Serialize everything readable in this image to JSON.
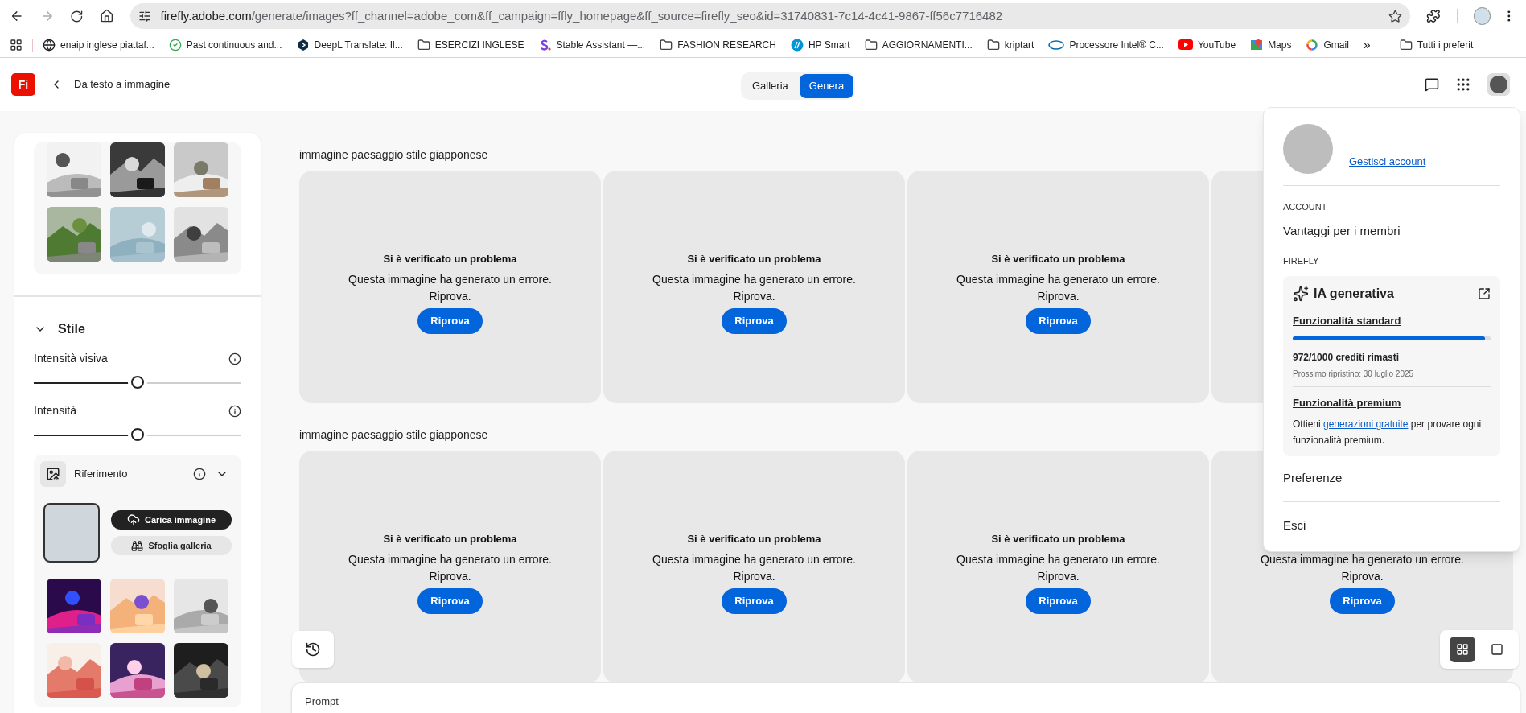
{
  "browser": {
    "url_host": "firefly.adobe.com",
    "url_path": "/generate/images?ff_channel=adobe_com&ff_campaign=ffly_homepage&ff_source=firefly_seo&id=31740831-7c14-4c41-9867-ff56c7716482",
    "bookmarks": [
      {
        "kind": "globe",
        "label": "enaip inglese piattaf..."
      },
      {
        "kind": "check",
        "label": "Past continuous and..."
      },
      {
        "kind": "hexagon",
        "label": "DeepL Translate: Il..."
      },
      {
        "kind": "folder",
        "label": "ESERCIZI INGLESE"
      },
      {
        "kind": "s-logo",
        "label": "Stable Assistant —..."
      },
      {
        "kind": "folder",
        "label": "FASHION RESEARCH"
      },
      {
        "kind": "hp",
        "label": "HP Smart"
      },
      {
        "kind": "folder",
        "label": "AGGIORNAMENTI..."
      },
      {
        "kind": "folder",
        "label": "kriptart"
      },
      {
        "kind": "intel",
        "label": "Processore Intel® C..."
      },
      {
        "kind": "youtube",
        "label": "YouTube"
      },
      {
        "kind": "maps",
        "label": "Maps"
      },
      {
        "kind": "google",
        "label": "Gmail"
      }
    ],
    "overflow": "»",
    "all_bookmarks": "Tutti i preferit"
  },
  "header": {
    "logo": "Fi",
    "back_label": "Da testo a immagine",
    "tabs": [
      {
        "label": "Galleria",
        "selected": false
      },
      {
        "label": "Genera",
        "selected": true
      }
    ]
  },
  "sidebar": {
    "style": {
      "title": "Stile",
      "expanded": true,
      "sliders": [
        {
          "label": "Intensità visiva",
          "level": 0.5
        },
        {
          "label": "Intensità",
          "level": 0.5
        }
      ]
    },
    "reference": {
      "title": "Riferimento",
      "expanded": true,
      "upload_button": "Carica immagine",
      "browse_button": "Sfoglia galleria"
    }
  },
  "groups": [
    {
      "prompt": "immagine paesaggio stile giapponese",
      "cards": [
        {
          "title": "Si è verificato un problema",
          "message": "Questa immagine ha generato un errore.",
          "hint": "Riprova.",
          "button": "Riprova"
        },
        {
          "title": "Si è verificato un problema",
          "message": "Questa immagine ha generato un errore.",
          "hint": "Riprova.",
          "button": "Riprova"
        },
        {
          "title": "Si è verificato un problema",
          "message": "Questa immagine ha generato un errore.",
          "hint": "Riprova.",
          "button": "Riprova"
        }
      ]
    },
    {
      "prompt": "immagine paesaggio stile giapponese",
      "cards": [
        {
          "title": "Si è verificato un problema",
          "message": "Questa immagine ha generato un errore.",
          "hint": "Riprova.",
          "button": "Riprova"
        },
        {
          "title": "Si è verificato un problema",
          "message": "Questa immagine ha generato un errore.",
          "hint": "Riprova.",
          "button": "Riprova"
        },
        {
          "title": "Si è verificato un problema",
          "message": "Questa immagine ha generato un errore.",
          "hint": "Riprova.",
          "button": "Riprova"
        },
        {
          "message": "Questa immagine ha generato un errore.",
          "hint": "Riprova.",
          "button": "Riprova"
        }
      ]
    }
  ],
  "view_toggle": [
    {
      "kind": "grid",
      "selected": true
    },
    {
      "kind": "single",
      "selected": false
    }
  ],
  "prompt_bar": {
    "label": "Prompt"
  },
  "account_menu": {
    "manage_link": "Gestisci account",
    "account_heading": "ACCOUNT",
    "member_benefits": "Vantaggi per i membri",
    "firefly_heading": "FIREFLY",
    "genai": {
      "title": "IA generativa",
      "standard_title": "Funzionalità standard",
      "level": 0.97,
      "credits": "972/1000 crediti rimasti",
      "reset": "Prossimo ripristino: 30 luglio 2025",
      "premium_title": "Funzionalità premium",
      "premium_text": {
        "before": "Ottieni ",
        "link": "generazioni gratuite",
        "after": " per provare ogni funzionalità premium."
      }
    },
    "items": [
      "Preferenze",
      "Esci"
    ]
  }
}
